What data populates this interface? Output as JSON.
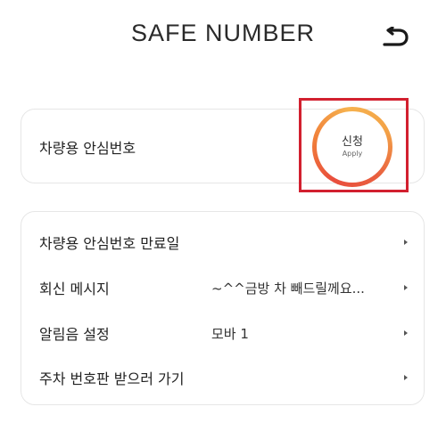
{
  "header": {
    "title": "SAFE NUMBER",
    "back_icon": "back-arrow-icon"
  },
  "vehicle_safe_number": {
    "label": "차량용 안심번호",
    "apply_button": {
      "main": "신청",
      "sub": "Apply"
    }
  },
  "settings": {
    "rows": [
      {
        "label": "차량용 안심번호 만료일",
        "value": ""
      },
      {
        "label": "회신 메시지",
        "value": "~^^금방 차 빼드릴께요..."
      },
      {
        "label": "알림음 설정",
        "value": "모바 1"
      },
      {
        "label": "주차 번호판 받으러 가기",
        "value": ""
      }
    ]
  },
  "colors": {
    "highlight_border": "#d2202f",
    "apply_ring_start": "#e94e3d",
    "apply_ring_end": "#f6b24e"
  }
}
